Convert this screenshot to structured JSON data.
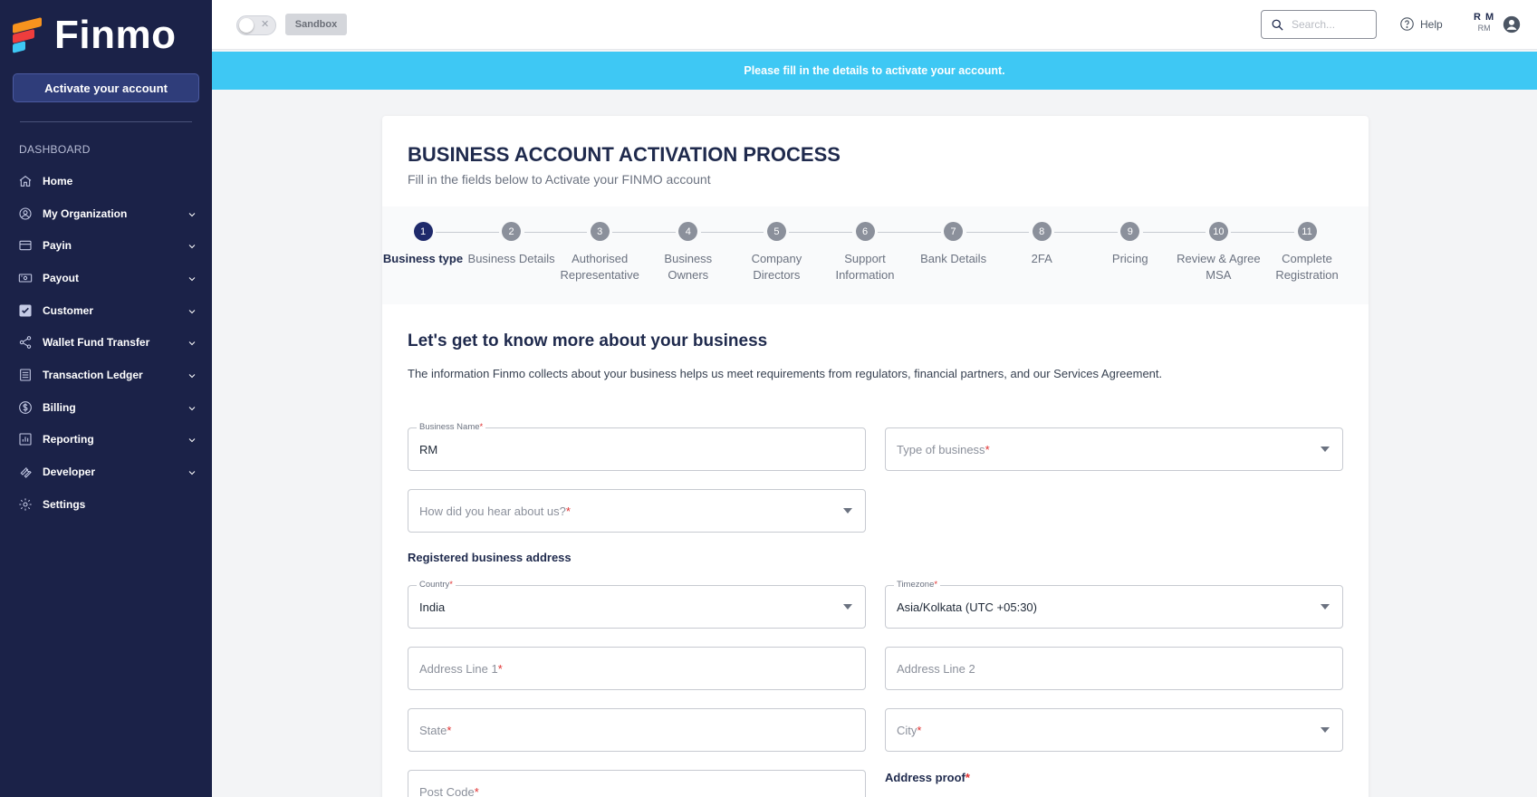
{
  "brand": {
    "name": "Finmo"
  },
  "sidebar": {
    "activate_label": "Activate your account",
    "section_label": "DASHBOARD",
    "items": [
      {
        "label": "Home",
        "icon": "home-icon",
        "has_chevron": false
      },
      {
        "label": "My Organization",
        "icon": "organization-icon",
        "has_chevron": true
      },
      {
        "label": "Payin",
        "icon": "card-icon",
        "has_chevron": true
      },
      {
        "label": "Payout",
        "icon": "cash-icon",
        "has_chevron": true
      },
      {
        "label": "Customer",
        "icon": "check-square-icon",
        "has_chevron": true
      },
      {
        "label": "Wallet Fund Transfer",
        "icon": "share-icon",
        "has_chevron": true
      },
      {
        "label": "Transaction Ledger",
        "icon": "ledger-icon",
        "has_chevron": true
      },
      {
        "label": "Billing",
        "icon": "dollar-icon",
        "has_chevron": true
      },
      {
        "label": "Reporting",
        "icon": "report-icon",
        "has_chevron": true
      },
      {
        "label": "Developer",
        "icon": "wrench-icon",
        "has_chevron": true
      },
      {
        "label": "Settings",
        "icon": "gear-icon",
        "has_chevron": false
      }
    ]
  },
  "topbar": {
    "sandbox_label": "Sandbox",
    "search_placeholder": "Search...",
    "help_label": "Help",
    "user_initials": "R M",
    "user_initials_small": "RM"
  },
  "banner": {
    "text": "Please fill in the details to activate your account."
  },
  "card": {
    "title": "BUSINESS ACCOUNT ACTIVATION PROCESS",
    "subtitle": "Fill in the fields below to Activate your FINMO account"
  },
  "steps": [
    {
      "number": "1",
      "label": "Business type",
      "active": true
    },
    {
      "number": "2",
      "label": "Business Details",
      "active": false
    },
    {
      "number": "3",
      "label": "Authorised Representative",
      "active": false
    },
    {
      "number": "4",
      "label": "Business Owners",
      "active": false
    },
    {
      "number": "5",
      "label": "Company Directors",
      "active": false
    },
    {
      "number": "6",
      "label": "Support Information",
      "active": false
    },
    {
      "number": "7",
      "label": "Bank Details",
      "active": false
    },
    {
      "number": "8",
      "label": "2FA",
      "active": false
    },
    {
      "number": "9",
      "label": "Pricing",
      "active": false
    },
    {
      "number": "10",
      "label": "Review & Agree MSA",
      "active": false
    },
    {
      "number": "11",
      "label": "Complete Registration",
      "active": false
    }
  ],
  "form": {
    "section_title": "Let's get to know more about your business",
    "section_desc": "The information Finmo collects about your business helps us meet requirements from regulators, financial partners, and our Services Agreement.",
    "business_name": {
      "label": "Business Name",
      "value": "RM"
    },
    "type_of_business": {
      "placeholder": "Type of business"
    },
    "hear_about": {
      "placeholder": "How did you hear about us?"
    },
    "address_heading": "Registered business address",
    "country": {
      "label": "Country",
      "value": "India"
    },
    "timezone": {
      "label": "Timezone",
      "value": "Asia/Kolkata (UTC +05:30)"
    },
    "address_line1": {
      "placeholder": "Address Line 1"
    },
    "address_line2": {
      "placeholder": "Address Line 2"
    },
    "state": {
      "placeholder": "State"
    },
    "city": {
      "placeholder": "City"
    },
    "post_code": {
      "placeholder": "Post Code"
    },
    "address_proof_label": "Address proof"
  }
}
